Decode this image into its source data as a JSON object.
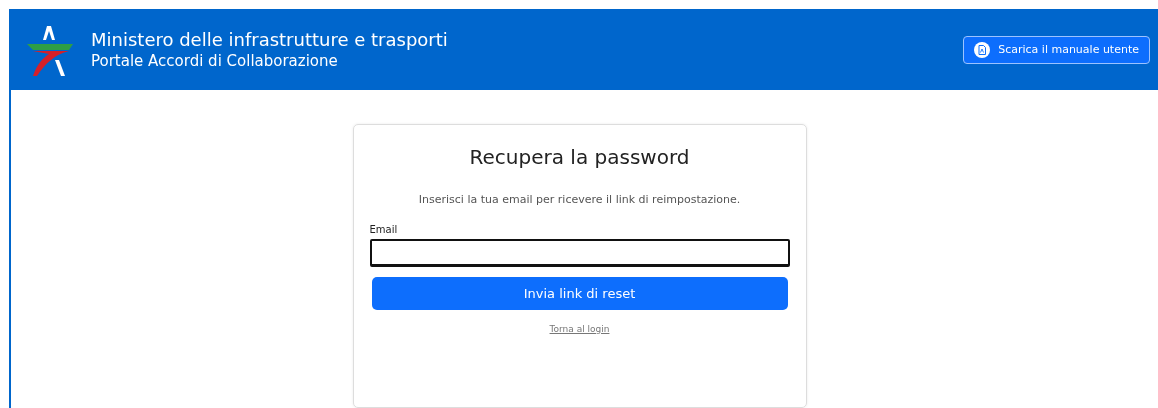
{
  "header": {
    "title": "Ministero delle infrastrutture e trasporti",
    "subtitle": "Portale Accordi di Collaborazione",
    "manual_button": "Scarica il manuale utente"
  },
  "card": {
    "title": "Recupera la password",
    "description": "Inserisci la tua email per ricevere il link di reimpostazione.",
    "email": {
      "label": "Email",
      "focused": true
    },
    "submit": "Invia link di reset",
    "back_link": "Torna al login"
  }
}
